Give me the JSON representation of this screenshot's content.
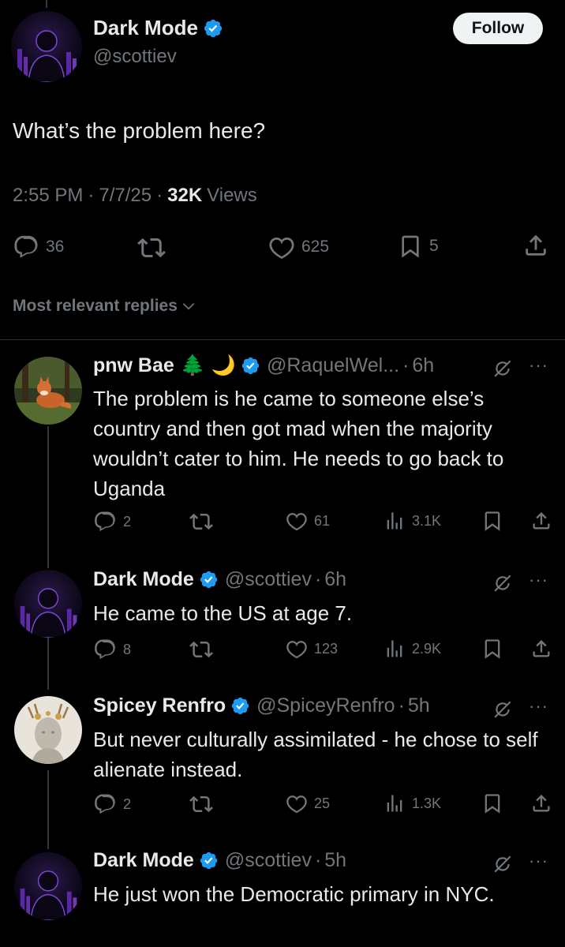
{
  "main_tweet": {
    "author_name": "Dark Mode",
    "handle": "@scottiev",
    "follow_label": "Follow",
    "text": "What’s the problem here?",
    "time": "2:55 PM",
    "sep1": "·",
    "date": "7/7/25",
    "sep2": "·",
    "views_count": "32K",
    "views_label": "Views",
    "actions": {
      "replies": "36",
      "likes": "625",
      "bookmarks": "5"
    }
  },
  "replies_header": "Most relevant replies",
  "replies": [
    {
      "name": "pnw Bae",
      "emoji": "🌲 🌙",
      "handle": "@RaquelWel...",
      "sep": "·",
      "time": "6h",
      "text": "The problem is he came to someone else’s country and then got mad when the majority wouldn’t cater to him. He needs to go back to Uganda",
      "more": "···",
      "replies": "2",
      "likes": "61",
      "views": "3.1K"
    },
    {
      "name": "Dark Mode",
      "handle": "@scottiev",
      "sep": "·",
      "time": "6h",
      "text": "He came to the US at age 7.",
      "more": "···",
      "replies": "8",
      "likes": "123",
      "views": "2.9K"
    },
    {
      "name": "Spicey Renfro",
      "handle": "@SpiceyRenfro",
      "sep": "·",
      "time": "5h",
      "text": "But never culturally assimilated - he chose to self alienate instead.",
      "more": "···",
      "replies": "2",
      "likes": "25",
      "views": "1.3K"
    },
    {
      "name": "Dark Mode",
      "handle": "@scottiev",
      "sep": "·",
      "time": "5h",
      "text": "He just won the Democratic primary in NYC.",
      "more": "···"
    }
  ],
  "colors": {
    "background": "#000000",
    "text": "#e7e9ea",
    "muted": "#71767b",
    "verified": "#1d9bf0",
    "divider": "#2f3336"
  }
}
